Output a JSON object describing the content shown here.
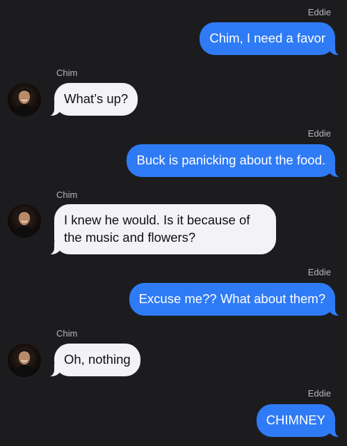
{
  "conversation": {
    "messages": [
      {
        "sender": "Eddie",
        "direction": "outgoing",
        "text": "Chim, I need a favor"
      },
      {
        "sender": "Chim",
        "direction": "incoming",
        "text": "What’s up?"
      },
      {
        "sender": "Eddie",
        "direction": "outgoing",
        "text": "Buck is panicking about the food."
      },
      {
        "sender": "Chim",
        "direction": "incoming",
        "text": "I knew he would. Is it because of\nthe music and flowers?"
      },
      {
        "sender": "Eddie",
        "direction": "outgoing",
        "text": "Excuse me?? What about them?"
      },
      {
        "sender": "Chim",
        "direction": "incoming",
        "text": "Oh, nothing"
      },
      {
        "sender": "Eddie",
        "direction": "outgoing",
        "text": "CHIMNEY"
      }
    ]
  },
  "colors": {
    "background": "#1c1c1e",
    "outgoing_bubble": "#2f7bf6",
    "incoming_bubble": "#f2f2f7",
    "sender_label": "#b8b8bd"
  },
  "icons": {
    "contact_avatar": "person-photo-avatar"
  }
}
